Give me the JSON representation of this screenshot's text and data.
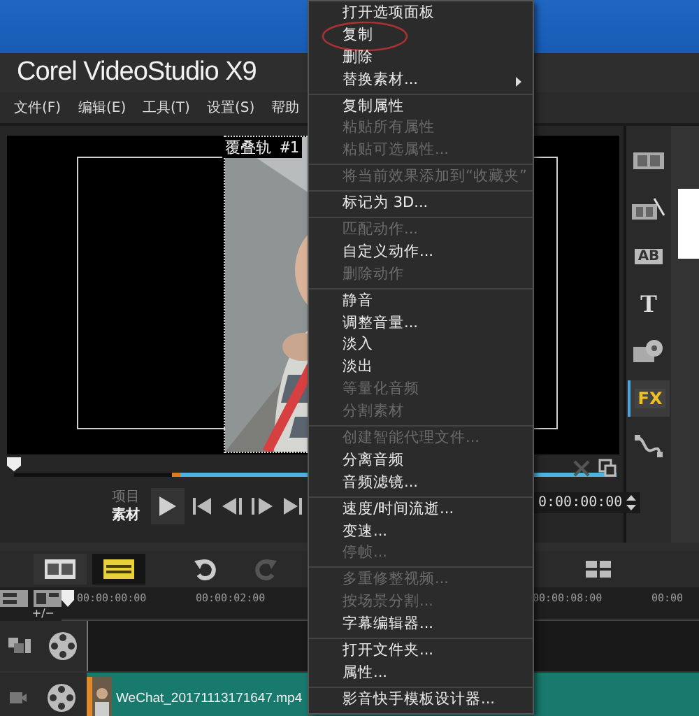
{
  "window": {
    "title": "Corel VideoStudio X9"
  },
  "menubar": [
    "文件(F)",
    "编辑(E)",
    "工具(T)",
    "设置(S)",
    "帮助"
  ],
  "preview": {
    "overlay_label": "覆叠轨 #1",
    "playhead": {
      "level": 0
    },
    "modes": [
      {
        "label": "项目",
        "selected": false
      },
      {
        "label": "素材",
        "selected": true
      }
    ],
    "timecode": "0:00:00:00"
  },
  "side_tabs": [
    {
      "kind": "media",
      "selected": false
    },
    {
      "kind": "instant",
      "selected": false
    },
    {
      "kind": "transition",
      "label": "AB",
      "selected": false
    },
    {
      "kind": "title",
      "label": "T",
      "selected": false
    },
    {
      "kind": "graphic",
      "selected": false
    },
    {
      "kind": "filter",
      "label": "FX",
      "selected": true
    },
    {
      "kind": "path",
      "selected": false
    }
  ],
  "timeline": {
    "views": [
      {
        "kind": "storyboard",
        "selected": false
      },
      {
        "kind": "timeline",
        "selected": true
      }
    ],
    "undo": {
      "disabled": false
    },
    "redo": {
      "disabled": true
    },
    "track_controls": "+/−",
    "ruler_left": [
      "00:00:00:00",
      "00:00:02:00"
    ],
    "ruler_right": [
      "00:00:08:00",
      "00:00"
    ],
    "clip": "WeChat_20171113171647.mp4"
  },
  "context_menu": {
    "groups": [
      [
        {
          "label": "打开选项面板",
          "disabled": false
        },
        {
          "label": "复制",
          "disabled": false,
          "circled": true
        },
        {
          "label": "删除",
          "disabled": false
        },
        {
          "label": "替换素材...",
          "disabled": false,
          "submenu": true
        }
      ],
      [
        {
          "label": "复制属性",
          "disabled": false
        },
        {
          "label": "粘贴所有属性",
          "disabled": true
        },
        {
          "label": "粘贴可选属性...",
          "disabled": true
        }
      ],
      [
        {
          "label": "将当前效果添加到“收藏夹”",
          "disabled": true
        }
      ],
      [
        {
          "label": "标记为 3D...",
          "disabled": false
        }
      ],
      [
        {
          "label": "匹配动作...",
          "disabled": true
        },
        {
          "label": "自定义动作...",
          "disabled": false
        },
        {
          "label": "删除动作",
          "disabled": true
        }
      ],
      [
        {
          "label": "静音",
          "disabled": false
        },
        {
          "label": "调整音量...",
          "disabled": false
        },
        {
          "label": "淡入",
          "disabled": false
        },
        {
          "label": "淡出",
          "disabled": false
        },
        {
          "label": "等量化音频",
          "disabled": true
        },
        {
          "label": "分割素材",
          "disabled": true
        }
      ],
      [
        {
          "label": "创建智能代理文件...",
          "disabled": true
        },
        {
          "label": "分离音频",
          "disabled": false
        },
        {
          "label": "音频滤镜...",
          "disabled": false
        }
      ],
      [
        {
          "label": "速度/时间流逝...",
          "disabled": false
        },
        {
          "label": "变速...",
          "disabled": false
        },
        {
          "label": "停帧...",
          "disabled": true
        }
      ],
      [
        {
          "label": "多重修整视频...",
          "disabled": true
        },
        {
          "label": "按场景分割...",
          "disabled": true
        },
        {
          "label": "字幕编辑器...",
          "disabled": false
        }
      ],
      [
        {
          "label": "打开文件夹...",
          "disabled": false
        },
        {
          "label": "属性...",
          "disabled": false
        }
      ],
      [
        {
          "label": "影音快手模板设计器...",
          "disabled": false
        }
      ]
    ]
  }
}
